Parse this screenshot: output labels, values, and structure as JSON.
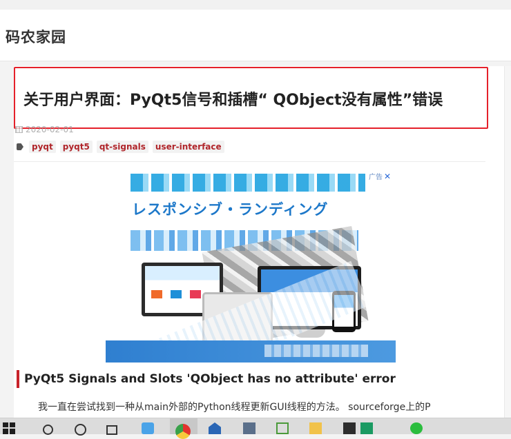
{
  "site": {
    "title": "码农家园"
  },
  "post": {
    "title": "关于用户界面：PyQt5信号和插槽“ QObject没有属性”错误",
    "date": "2020-02-01",
    "tags": [
      "pyqt",
      "pyqt5",
      "qt-signals",
      "user-interface"
    ]
  },
  "ad": {
    "label": "广告",
    "close": "✕",
    "headline": "レスポンシブ・ランディング"
  },
  "article": {
    "heading": "PyQt5 Signals and Slots 'QObject has no attribute' error",
    "paragraph": "我一直在尝试找到一种从main外部的Python线程更新GUI线程的方法。 sourceforge上的P"
  },
  "taskbar": {
    "icons": [
      "windows-start-icon",
      "search-icon",
      "cortana-icon",
      "task-view-icon",
      "app-icon",
      "chrome-icon",
      "mail-icon",
      "calculator-icon",
      "green-app-icon",
      "folder-icon",
      "terminal-icon",
      "pycharm-icon",
      "wechat-icon"
    ]
  },
  "colors": {
    "highlight_border": "#e5202a",
    "tag_text": "#b0252a",
    "heading_accent": "#c8222a"
  }
}
